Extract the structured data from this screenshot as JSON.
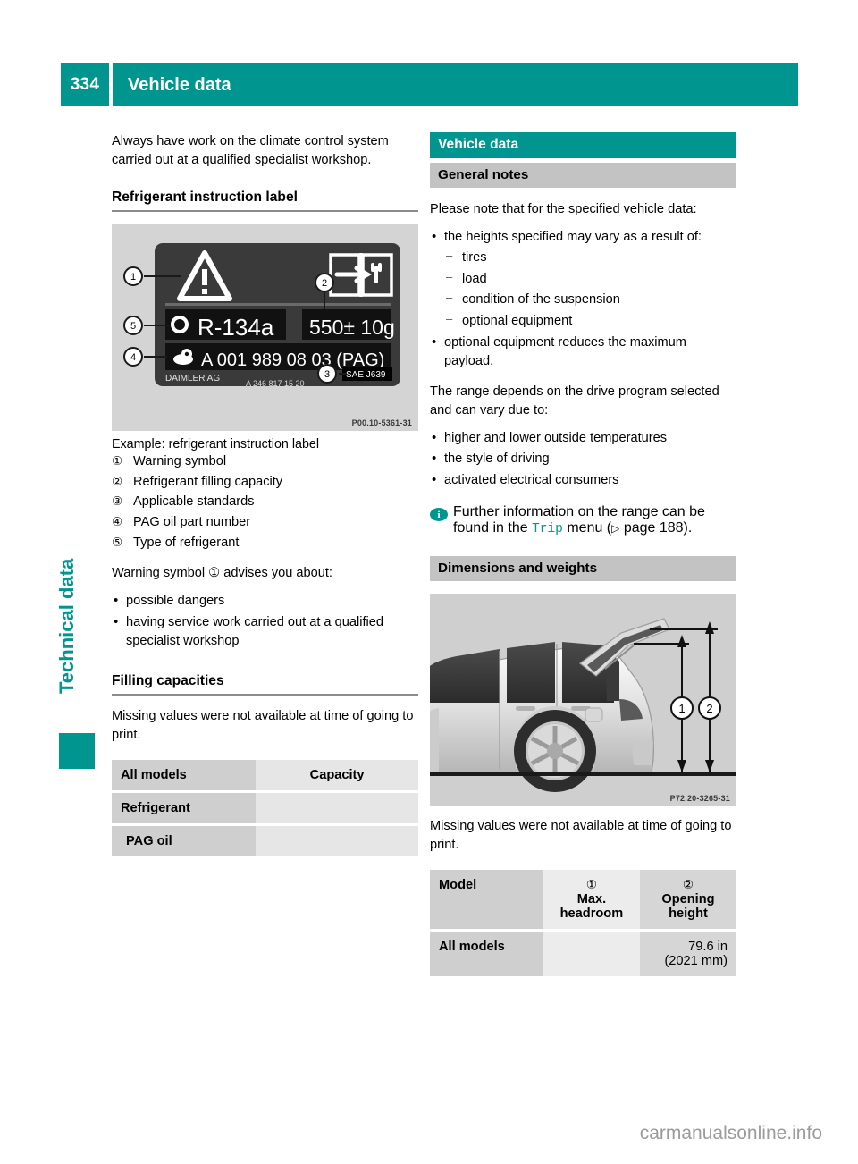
{
  "header": {
    "page_number": "334",
    "title": "Vehicle data"
  },
  "side_tab": {
    "label": "Technical data"
  },
  "left_column": {
    "intro": "Always have work on the climate control system carried out at a qualified specialist workshop.",
    "heading_refrigerant": "Refrigerant instruction label",
    "figure_label": {
      "warning_triangle": "!",
      "type_line": "R-134a",
      "capacity_line": "550 ± 10g",
      "pag_line": "A 001 989 08 03 (PAG)",
      "maker": "DAIMLER AG",
      "part_number": "A 246 817 15 20",
      "standard": "SAE J639",
      "callouts": [
        "1",
        "2",
        "3",
        "4",
        "5"
      ],
      "figure_code": "P00.10-5361-31"
    },
    "caption": "Example: refrigerant instruction label",
    "legend": [
      {
        "marker": "①",
        "text": "Warning symbol"
      },
      {
        "marker": "②",
        "text": "Refrigerant filling capacity"
      },
      {
        "marker": "③",
        "text": "Applicable standards"
      },
      {
        "marker": "④",
        "text": "PAG oil part number"
      },
      {
        "marker": "⑤",
        "text": "Type of refrigerant"
      }
    ],
    "warning_intro_pre": "Warning symbol ",
    "warning_intro_marker": "①",
    "warning_intro_post": " advises you about:",
    "warning_bullets": [
      "possible dangers",
      "having service work carried out at a qualified specialist workshop"
    ],
    "heading_filling": "Filling capacities",
    "filling_note": "Missing values were not available at time of going to print.",
    "filling_table": {
      "headers": [
        "All models",
        "Capacity"
      ],
      "rows": [
        [
          "Refrigerant",
          ""
        ],
        [
          "PAG oil",
          ""
        ]
      ]
    }
  },
  "right_column": {
    "section_title": "Vehicle data",
    "subsection_general": "General notes",
    "general_intro": "Please note that for the specified vehicle data:",
    "bullets_1": [
      "the heights specified may vary as a result of:"
    ],
    "sub_dashes": [
      "tires",
      "load",
      "condition of the suspension",
      "optional equipment"
    ],
    "bullets_2": [
      "optional equipment reduces the maximum payload."
    ],
    "range_intro": "The range depends on the drive program selected and can vary due to:",
    "range_bullets": [
      "higher and lower outside temperatures",
      "the style of driving",
      "activated electrical consumers"
    ],
    "note": {
      "icon": "i",
      "text_before": "Further information on the range can be found in the ",
      "menu_name": "Trip",
      "text_mid": " menu (",
      "triangle": "▷",
      "page_ref": " page 188).",
      "text_after": ""
    },
    "subsection_dimensions": "Dimensions and weights",
    "figure_vehicle": {
      "callouts": [
        "1",
        "2"
      ],
      "figure_code": "P72.20-3265-31"
    },
    "dimensions_note": "Missing values were not available at time of going to print.",
    "dimensions_table": {
      "headers": [
        {
          "label": "Model",
          "marker": ""
        },
        {
          "label": "Max. headroom",
          "marker": "①"
        },
        {
          "label": "Opening height",
          "marker": "②"
        }
      ],
      "rows": [
        {
          "model": "All models",
          "max_headroom": "",
          "opening_height_in": "79.6 in",
          "opening_height_mm": "(2021 mm)"
        }
      ]
    }
  },
  "footer": {
    "watermark": "carmanualsonline.info"
  },
  "colors": {
    "accent_teal": "#00968f",
    "bar_gray": "#c3c3c3",
    "table_dark": "#cfcfcf",
    "table_light": "#e6e6e6"
  }
}
